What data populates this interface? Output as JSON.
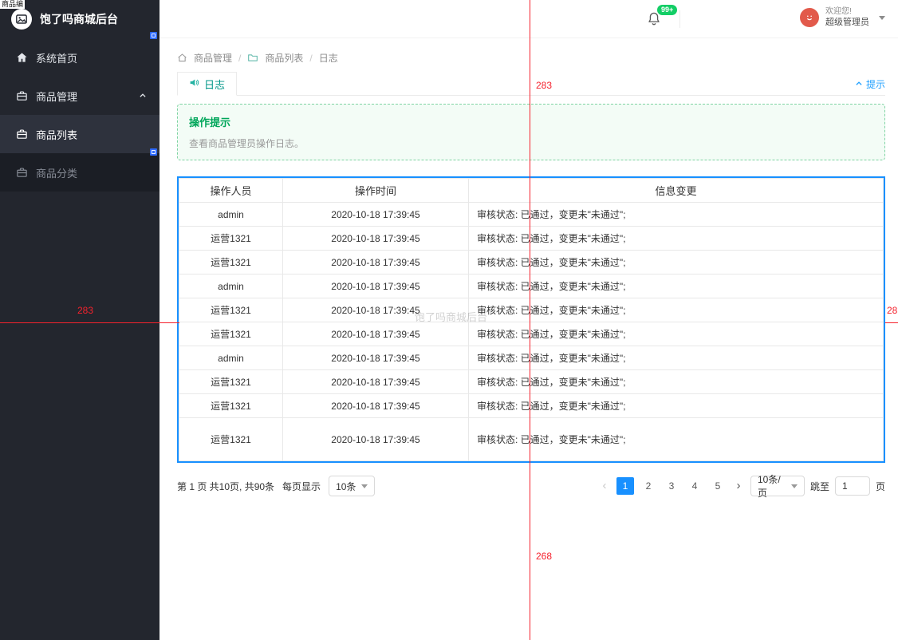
{
  "app": {
    "watermark": "饱了吗商城后台"
  },
  "colors": {
    "accent_teal": "#009688",
    "link_blue": "#1E9FFF",
    "selection_blue": "#1890ff",
    "pagination_active_blue": "#1890ff",
    "badge_green": "#13ce66",
    "alert_green": "#00a65a",
    "annotation_red": "#f5222d",
    "avatar_red": "#e25a4b",
    "sidebar_dark": "#23262e"
  },
  "sidebar": {
    "logo_text": "饱了吗商城后台",
    "items": [
      {
        "label": "系统首页"
      },
      {
        "label": "商品管理"
      },
      {
        "label": "商品列表"
      },
      {
        "label": "商品分类"
      }
    ]
  },
  "header": {
    "notification_badge": "99+",
    "welcome_line1": "欢迎您!",
    "welcome_line2": "超级管理员"
  },
  "breadcrumb": {
    "item1": "商品管理",
    "item2": "商品列表",
    "item3": "日志",
    "separator": "/"
  },
  "tabs": {
    "active_tab": "日志",
    "hint_link": "提示"
  },
  "alert": {
    "title": "操作提示",
    "body": "查看商品管理员操作日志。"
  },
  "table": {
    "col1": "操作人员",
    "col2": "操作时间",
    "col3": "信息变更",
    "rows": [
      {
        "user": "admin",
        "time": "2020-10-18 17:39:45",
        "info": "审核状态: 已通过，变更未\"未通过\";"
      },
      {
        "user": "运营1321",
        "time": "2020-10-18 17:39:45",
        "info": "审核状态: 已通过，变更未\"未通过\";"
      },
      {
        "user": "运营1321",
        "time": "2020-10-18 17:39:45",
        "info": "审核状态: 已通过，变更未\"未通过\";"
      },
      {
        "user": "admin",
        "time": "2020-10-18 17:39:45",
        "info": "审核状态: 已通过，变更未\"未通过\";"
      },
      {
        "user": "运营1321",
        "time": "2020-10-18 17:39:45",
        "info": "审核状态: 已通过，变更未\"未通过\";"
      },
      {
        "user": "运营1321",
        "time": "2020-10-18 17:39:45",
        "info": "审核状态: 已通过，变更未\"未通过\";"
      },
      {
        "user": "admin",
        "time": "2020-10-18 17:39:45",
        "info": "审核状态: 已通过，变更未\"未通过\";"
      },
      {
        "user": "运营1321",
        "time": "2020-10-18 17:39:45",
        "info": "审核状态: 已通过，变更未\"未通过\";"
      },
      {
        "user": "运营1321",
        "time": "2020-10-18 17:39:45",
        "info": "审核状态: 已通过，变更未\"未通过\";"
      },
      {
        "user": "运营1321",
        "time": "2020-10-18 17:39:45",
        "info": "审核状态: 已通过，变更未\"未通过\";"
      }
    ]
  },
  "pagination": {
    "summary": "第 1 页 共10页, 共90条",
    "per_page_label": "每页显示",
    "per_page_value": "10条",
    "prev": "‹",
    "next": "›",
    "page1": "1",
    "page2": "2",
    "page3": "3",
    "page4": "4",
    "page5": "5",
    "size_select": "10条/页",
    "jump_label": "跳至",
    "jump_value": "1",
    "jump_suffix": "页"
  },
  "annotations": {
    "corner_text": "商品编",
    "vline_top_label": "283",
    "vline_bottom_label": "268",
    "hline_left_label": "283",
    "hline_right_label": "28"
  }
}
